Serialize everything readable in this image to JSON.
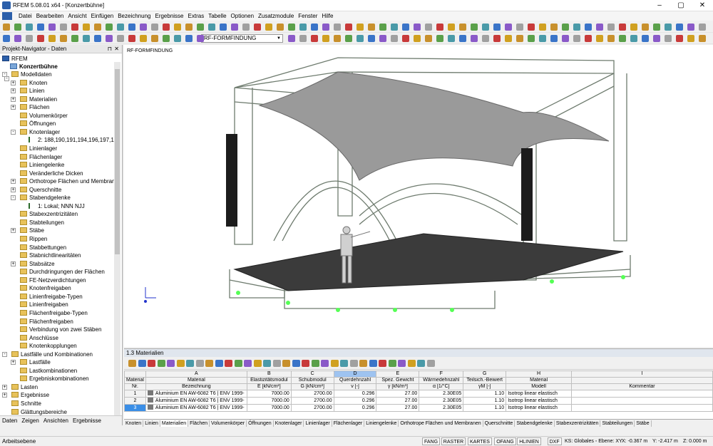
{
  "window": {
    "title": "RFEM 5.08.01 x64 - [Konzertbühne]"
  },
  "menu": [
    "Datei",
    "Bearbeiten",
    "Ansicht",
    "Einfügen",
    "Bezeichnung",
    "Ergebnisse",
    "Extras",
    "Tabelle",
    "Optionen",
    "Zusatzmodule",
    "Fenster",
    "Hilfe"
  ],
  "toolbar": {
    "loadcase": "RF-FORMFINDUNG"
  },
  "navigator": {
    "title": "Projekt-Navigator - Daten",
    "root": "RFEM",
    "project": "Konzertbühne",
    "items": [
      {
        "label": "Modelldaten",
        "d": 1,
        "exp": "-"
      },
      {
        "label": "Knoten",
        "d": 2,
        "exp": "+"
      },
      {
        "label": "Linien",
        "d": 2,
        "exp": "+"
      },
      {
        "label": "Materialien",
        "d": 2,
        "exp": "+"
      },
      {
        "label": "Flächen",
        "d": 2,
        "exp": "+"
      },
      {
        "label": "Volumenkörper",
        "d": 2,
        "exp": ""
      },
      {
        "label": "Öffnungen",
        "d": 2,
        "exp": ""
      },
      {
        "label": "Knotenlager",
        "d": 2,
        "exp": "-"
      },
      {
        "label": "2: 188,190,191,194,196,197,199",
        "d": 3,
        "exp": "",
        "leaf": true
      },
      {
        "label": "Linienlager",
        "d": 2,
        "exp": ""
      },
      {
        "label": "Flächenlager",
        "d": 2,
        "exp": ""
      },
      {
        "label": "Liniengelenke",
        "d": 2,
        "exp": ""
      },
      {
        "label": "Veränderliche Dicken",
        "d": 2,
        "exp": ""
      },
      {
        "label": "Orthotrope Flächen und Membran",
        "d": 2,
        "exp": "+"
      },
      {
        "label": "Querschnitte",
        "d": 2,
        "exp": "+"
      },
      {
        "label": "Stabendgelenke",
        "d": 2,
        "exp": "-"
      },
      {
        "label": "1: Lokal; NNN NJJ",
        "d": 3,
        "exp": "",
        "leaf": true
      },
      {
        "label": "Stabexzentrizitäten",
        "d": 2,
        "exp": ""
      },
      {
        "label": "Stabteilungen",
        "d": 2,
        "exp": ""
      },
      {
        "label": "Stäbe",
        "d": 2,
        "exp": "+"
      },
      {
        "label": "Rippen",
        "d": 2,
        "exp": ""
      },
      {
        "label": "Stabbettungen",
        "d": 2,
        "exp": ""
      },
      {
        "label": "Stabnichtlinearitäten",
        "d": 2,
        "exp": ""
      },
      {
        "label": "Stabsätze",
        "d": 2,
        "exp": "+"
      },
      {
        "label": "Durchdringungen der Flächen",
        "d": 2,
        "exp": ""
      },
      {
        "label": "FE-Netzverdichtungen",
        "d": 2,
        "exp": ""
      },
      {
        "label": "Knotenfreigaben",
        "d": 2,
        "exp": ""
      },
      {
        "label": "Linienfreigabe-Typen",
        "d": 2,
        "exp": ""
      },
      {
        "label": "Linienfreigaben",
        "d": 2,
        "exp": ""
      },
      {
        "label": "Flächenfreigabe-Typen",
        "d": 2,
        "exp": ""
      },
      {
        "label": "Flächenfreigaben",
        "d": 2,
        "exp": ""
      },
      {
        "label": "Verbindung von zwei Stäben",
        "d": 2,
        "exp": ""
      },
      {
        "label": "Anschlüsse",
        "d": 2,
        "exp": ""
      },
      {
        "label": "Knotenkopplungen",
        "d": 2,
        "exp": ""
      },
      {
        "label": "Lastfälle und Kombinationen",
        "d": 1,
        "exp": "-"
      },
      {
        "label": "Lastfälle",
        "d": 2,
        "exp": "+"
      },
      {
        "label": "Lastkombinationen",
        "d": 2,
        "exp": ""
      },
      {
        "label": "Ergebniskombinationen",
        "d": 2,
        "exp": ""
      },
      {
        "label": "Lasten",
        "d": 1,
        "exp": "+"
      },
      {
        "label": "Ergebnisse",
        "d": 1,
        "exp": "+"
      },
      {
        "label": "Schnitte",
        "d": 1,
        "exp": ""
      },
      {
        "label": "Glättungsbereiche",
        "d": 1,
        "exp": ""
      }
    ],
    "tabs": [
      "Daten",
      "Zeigen",
      "Ansichten",
      "Ergebnisse"
    ]
  },
  "view": {
    "label": "RF-FORMFINDUNG"
  },
  "table": {
    "title": "1.3 Materialien",
    "colLetters": [
      "",
      "A",
      "B",
      "C",
      "D",
      "E",
      "F",
      "G",
      "H",
      "I"
    ],
    "headers1": [
      "Material",
      "Material",
      "Elastizitätsmodul",
      "Schubmodul",
      "Querdehnzahl",
      "Spez. Gewicht",
      "Wärmedehnzahl",
      "Teilsich.-Beiwert",
      "Material",
      ""
    ],
    "headers2": [
      "Nr.",
      "Bezeichnung",
      "E [kN/cm²]",
      "G [kN/cm²]",
      "ν [-]",
      "γ [kN/m³]",
      "α [1/°C]",
      "γM [-]",
      "Modell",
      "Kommentar"
    ],
    "rows": [
      [
        "1",
        "Aluminium EN AW-6082 T6 | ENV 1999-",
        "7000.00",
        "2700.00",
        "0.296",
        "27.00",
        "2.30E05",
        "1.10",
        "Isotrop linear elastisch",
        ""
      ],
      [
        "2",
        "Aluminium EN AW-6082 T6 | ENV 1999-",
        "7000.00",
        "2700.00",
        "0.296",
        "27.00",
        "2.30E05",
        "1.10",
        "Isotrop linear elastisch",
        ""
      ],
      [
        "3",
        "Aluminium EN AW-6082 T6 | ENV 1999-",
        "7000.00",
        "2700.00",
        "0.296",
        "27.00",
        "2.30E05",
        "1.10",
        "Isotrop linear elastisch",
        ""
      ]
    ]
  },
  "sheettabs": [
    "Knoten",
    "Linien",
    "Materialien",
    "Flächen",
    "Volumenkörper",
    "Öffnungen",
    "Knotenlager",
    "Linienlager",
    "Flächenlager",
    "Liniengelenke",
    "Orthotrope Flächen und Membranen",
    "Querschnitte",
    "Stabendgelenke",
    "Stabexzentrizitäten",
    "Stabteilungen",
    "Stäbe"
  ],
  "status": {
    "left": "Arbeitsebene",
    "buttons": [
      "FANG",
      "RASTER",
      "KARTES",
      "OFANG",
      "HLINIEN",
      "DXF"
    ],
    "coords": "KS: Globales ◦ Ebene: XY",
    "x": "X: -0.367 m",
    "y": "Y: -2.417 m",
    "z": "Z: 0.000 m"
  }
}
